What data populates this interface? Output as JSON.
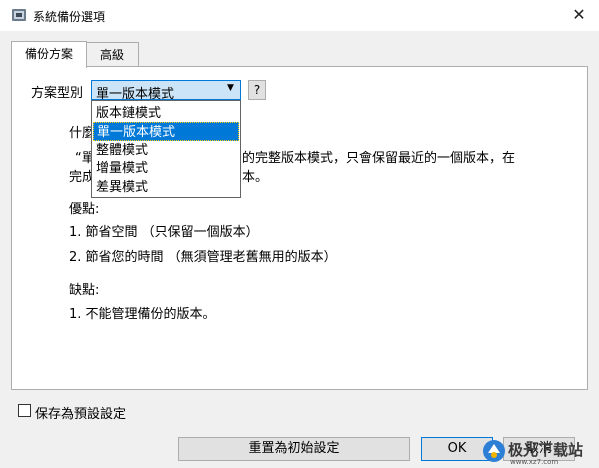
{
  "window": {
    "title": "系統備份選項",
    "close_glyph": "✕"
  },
  "tabs": [
    {
      "label": "備份方案",
      "active": true
    },
    {
      "label": "高級",
      "active": false
    }
  ],
  "scheme": {
    "label": "方案型別",
    "selected": "單一版本模式",
    "help_label": "?",
    "options": [
      "版本鏈模式",
      "單一版本模式",
      "整體模式",
      "增量模式",
      "差異模式"
    ]
  },
  "description": {
    "heading_partial": "什麼",
    "line1_start": "“單",
    "line1_end": "的完整版本模式，只會保留最近的一個版本，在",
    "line2_start": "完成",
    "line2_end": "本。",
    "pros_label": "優點:",
    "pros": [
      "1. 節省空間 （只保留一個版本）",
      "2. 節省您的時間 （無須管理老舊無用的版本）"
    ],
    "cons_label": "缺點:",
    "cons": [
      "1. 不能管理備份的版本。"
    ]
  },
  "footer": {
    "save_default_label": "保存為預設設定",
    "reset_label": "重置為初始設定",
    "ok_label": "OK",
    "cancel_label": "取消"
  },
  "watermark": {
    "text": "极光下载站",
    "url": "www.xz7.com"
  },
  "colors": {
    "accent": "#0078d7",
    "highlight": "#cce4f7",
    "panel_border": "#adadad"
  }
}
